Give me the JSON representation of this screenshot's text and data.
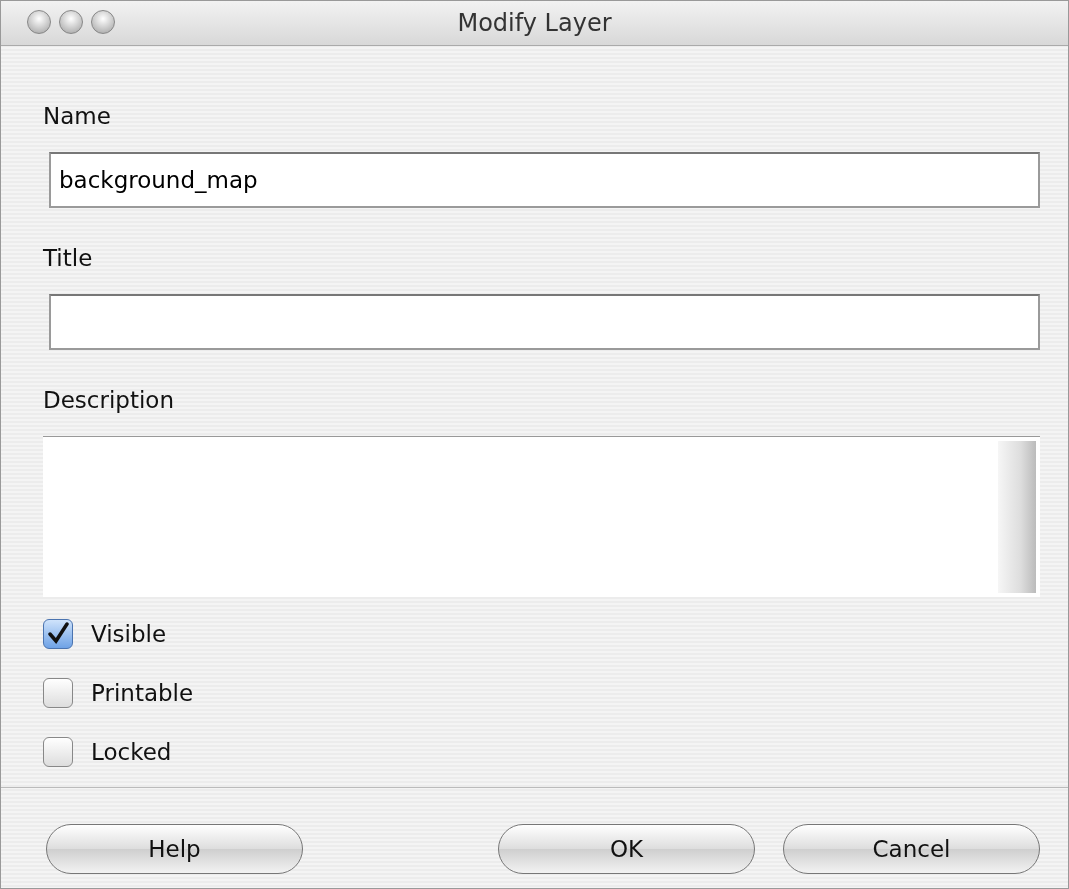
{
  "window": {
    "title": "Modify Layer"
  },
  "fields": [
    {
      "label": "Name",
      "value": "background_map"
    },
    {
      "label": "Title"
    }
  ],
  "description": {
    "label": "Description"
  },
  "checkboxes": [
    {
      "label": "Visible",
      "checked": true
    },
    {
      "label": "Printable",
      "checked": false
    },
    {
      "label": "Locked",
      "checked": false
    }
  ],
  "buttons": [
    {
      "label": "Help"
    },
    {
      "label": "OK"
    },
    {
      "label": "Cancel"
    }
  ]
}
